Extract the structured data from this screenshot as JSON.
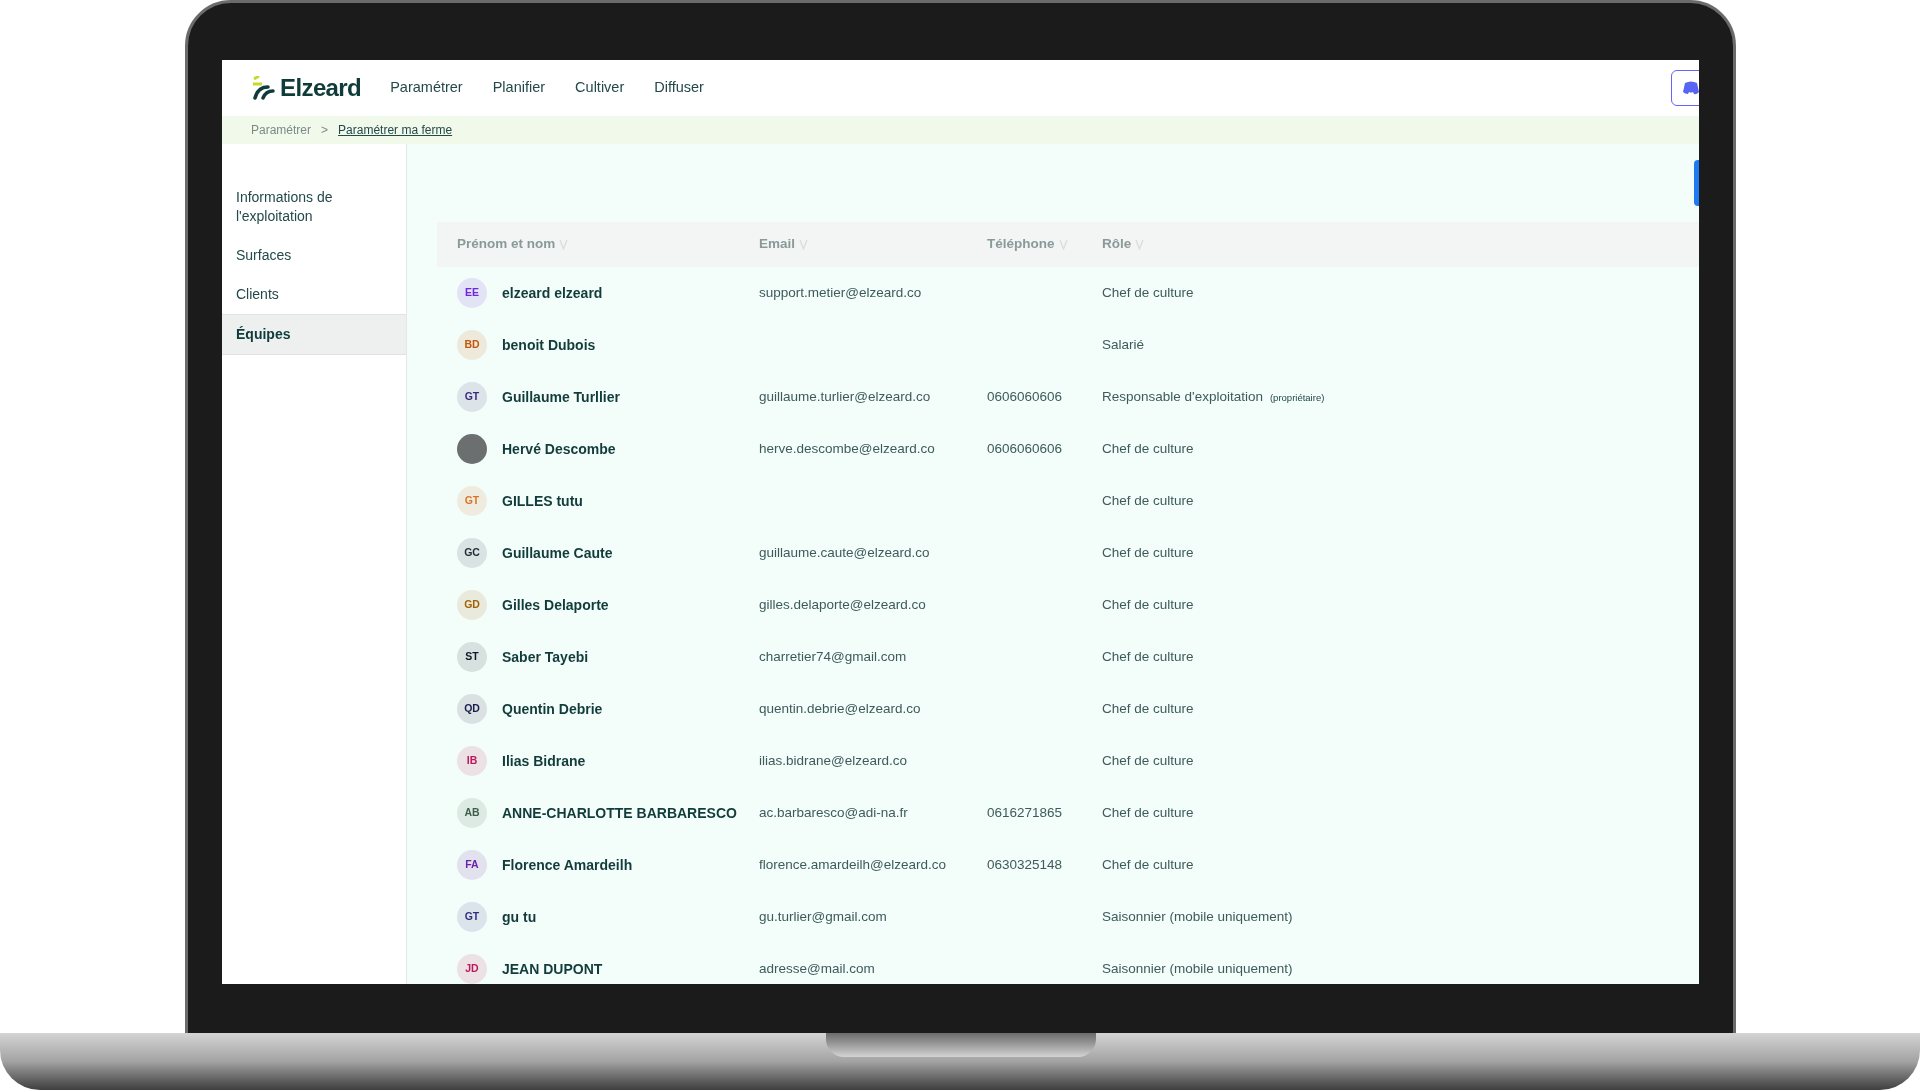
{
  "app": {
    "logo": "Elzeard",
    "nav": [
      {
        "label": "Paramétrer",
        "selected": false
      },
      {
        "label": "Planifier",
        "selected": false
      },
      {
        "label": "Cultiver",
        "selected": false
      },
      {
        "label": "Diffuser",
        "selected": false
      }
    ]
  },
  "breadcrumb": [
    {
      "label": "Paramétrer",
      "link": false
    },
    {
      "label": ">",
      "link": false
    },
    {
      "label": "Paramétrer ma ferme",
      "link": true
    }
  ],
  "sidebar": {
    "items": [
      {
        "label": "Informations de l'exploitation",
        "selected": false
      },
      {
        "label": "Surfaces",
        "selected": false
      },
      {
        "label": "Clients",
        "selected": false
      },
      {
        "label": "Équipes",
        "selected": true
      }
    ]
  },
  "table": {
    "columns": [
      "Prénom et nom",
      "Email",
      "Téléphone",
      "Rôle"
    ],
    "rows": [
      {
        "avatar": {
          "kind": "initials",
          "initials": "EE",
          "color": "#6d28d9"
        },
        "name": "elzeard elzeard",
        "email": "support.metier@elzeard.co",
        "phone": "",
        "role": "Chef de culture"
      },
      {
        "avatar": {
          "kind": "initials",
          "initials": "BD",
          "color": "#c2570c"
        },
        "name": "benoit Dubois",
        "email": "",
        "phone": "",
        "role": "Salarié"
      },
      {
        "avatar": {
          "kind": "initials",
          "initials": "GT",
          "color": "#3b2a7a"
        },
        "name": "Guillaume Turllier",
        "email": "guillaume.turlier@elzeard.co",
        "phone": "0606060606",
        "role": "Responsable d'exploitation",
        "role_note": "(propriétaire)"
      },
      {
        "avatar": {
          "kind": "photo"
        },
        "name": "Hervé Descombe",
        "email": "herve.descombe@elzeard.co",
        "phone": "0606060606",
        "role": "Chef de culture"
      },
      {
        "avatar": {
          "kind": "initials",
          "initials": "GT",
          "color": "#d9732b"
        },
        "name": "GILLES tutu",
        "email": "",
        "phone": "",
        "role": "Chef de culture"
      },
      {
        "avatar": {
          "kind": "initials",
          "initials": "GC",
          "color": "#1f2937"
        },
        "name": "Guillaume Caute",
        "email": "guillaume.caute@elzeard.co",
        "phone": "",
        "role": "Chef de culture"
      },
      {
        "avatar": {
          "kind": "initials",
          "initials": "GD",
          "color": "#a16207"
        },
        "name": "Gilles Delaporte",
        "email": "gilles.delaporte@elzeard.co",
        "phone": "",
        "role": "Chef de culture"
      },
      {
        "avatar": {
          "kind": "initials",
          "initials": "ST",
          "color": "#111827"
        },
        "name": "Saber Tayebi",
        "email": "charretier74@gmail.com",
        "phone": "",
        "role": "Chef de culture"
      },
      {
        "avatar": {
          "kind": "initials",
          "initials": "QD",
          "color": "#1e1b4b"
        },
        "name": "Quentin Debrie",
        "email": "quentin.debrie@elzeard.co",
        "phone": "",
        "role": "Chef de culture"
      },
      {
        "avatar": {
          "kind": "initials",
          "initials": "IB",
          "color": "#be185d"
        },
        "name": "Ilias Bidrane",
        "email": "ilias.bidrane@elzeard.co",
        "phone": "",
        "role": "Chef de culture"
      },
      {
        "avatar": {
          "kind": "initials",
          "initials": "AB",
          "color": "#3f5f4a"
        },
        "name": "ANNE-CHARLOTTE BARBARESCO",
        "email": "ac.barbaresco@adi-na.fr",
        "phone": "0616271865",
        "role": "Chef de culture"
      },
      {
        "avatar": {
          "kind": "initials",
          "initials": "FA",
          "color": "#6b21a8"
        },
        "name": "Florence Amardeilh",
        "email": "florence.amardeilh@elzeard.co",
        "phone": "0630325148",
        "role": "Chef de culture"
      },
      {
        "avatar": {
          "kind": "initials",
          "initials": "GT",
          "color": "#312e81"
        },
        "name": "gu tu",
        "email": "gu.turlier@gmail.com",
        "phone": "",
        "role": "Saisonnier (mobile uniquement)"
      },
      {
        "avatar": {
          "kind": "initials",
          "initials": "JD",
          "color": "#be185d"
        },
        "name": "JEAN DUPONT",
        "email": "adresse@mail.com",
        "phone": "",
        "role": "Saisonnier (mobile uniquement)"
      }
    ]
  }
}
